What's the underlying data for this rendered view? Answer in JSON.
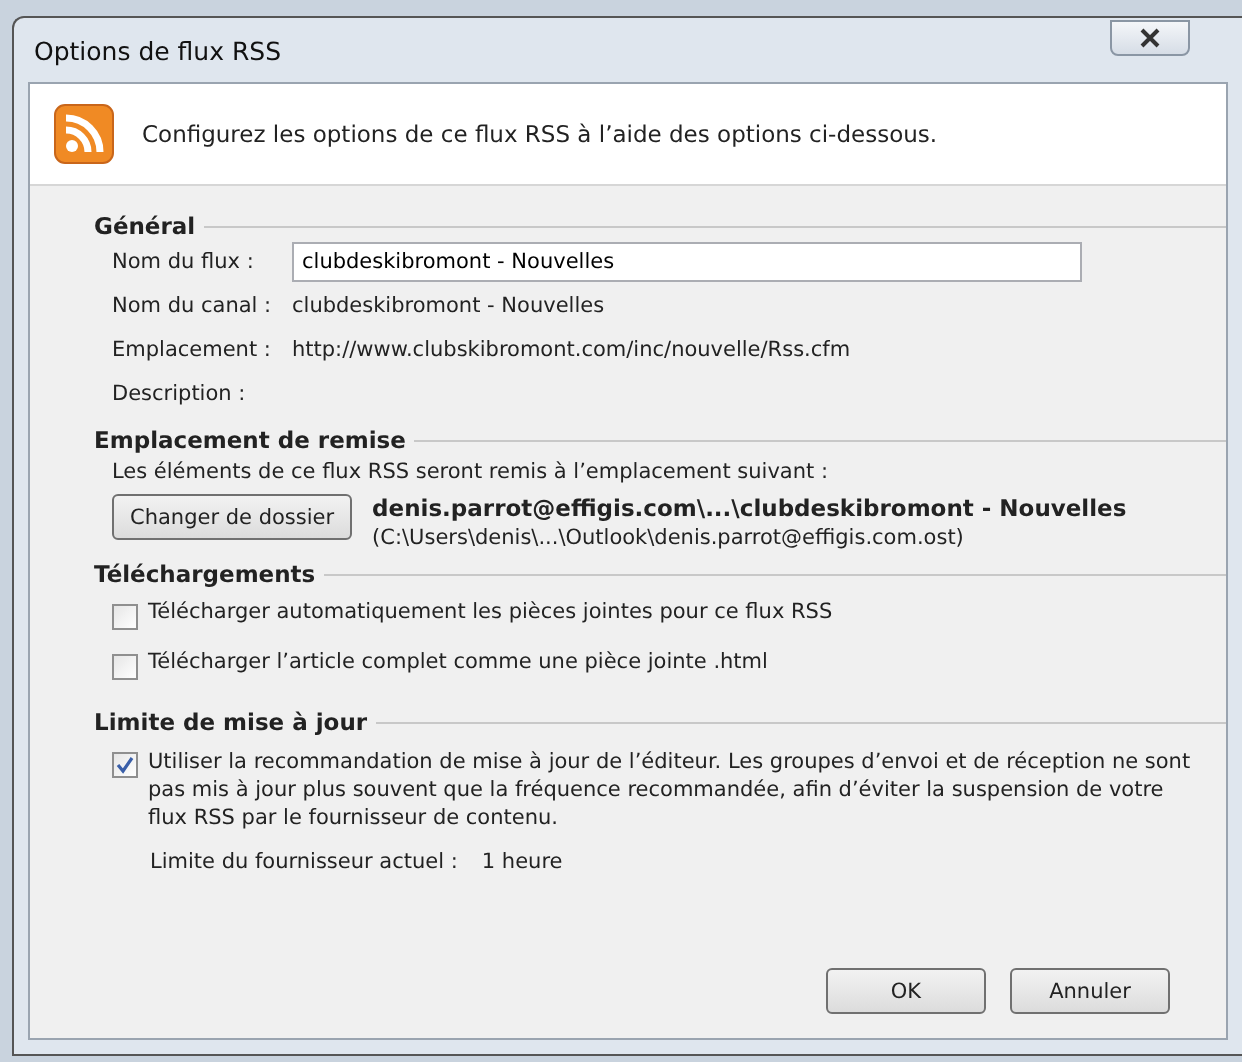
{
  "window": {
    "title": "Options de flux RSS"
  },
  "header": {
    "text": "Configurez les options de ce flux RSS à l’aide des options ci-dessous."
  },
  "general": {
    "heading": "Général",
    "fields": [
      {
        "kind": "input",
        "label": "Nom du flux :",
        "value": "clubdeskibromont - Nouvelles"
      },
      {
        "kind": "text",
        "label": "Nom du canal :",
        "value": "clubdeskibromont - Nouvelles"
      },
      {
        "kind": "text",
        "label": "Emplacement :",
        "value": "http://www.clubskibromont.com/inc/nouvelle/Rss.cfm"
      },
      {
        "kind": "text",
        "label": "Description :"
      }
    ]
  },
  "delivery": {
    "heading": "Emplacement de remise",
    "intro": "Les éléments de ce flux RSS seront remis à l’emplacement suivant :",
    "button": "Changer de dossier",
    "folder": "denis.parrot@effigis.com\\...\\clubdeskibromont - Nouvelles",
    "file": "(C:\\Users\\denis\\...\\Outlook\\denis.parrot@effigis.com.ost)"
  },
  "downloads": {
    "heading": "Téléchargements",
    "options": [
      {
        "label": "Télécharger automatiquement les pièces jointes pour ce flux RSS",
        "checked": false
      },
      {
        "label": "Télécharger l’article complet comme une pièce jointe .html",
        "checked": false
      }
    ]
  },
  "update_limit": {
    "heading": "Limite de mise à jour",
    "option": {
      "label": "Utiliser la recommandation de mise à jour de l’éditeur. Les groupes d’envoi et de réception ne sont pas mis à jour plus souvent que la fréquence recommandée, afin d’éviter la suspension de votre flux RSS par le fournisseur de contenu.",
      "checked": true
    },
    "limit_label": "Limite du fournisseur actuel :",
    "limit_value": "1 heure"
  },
  "buttons": [
    {
      "label": "OK"
    },
    {
      "label": "Annuler"
    }
  ]
}
